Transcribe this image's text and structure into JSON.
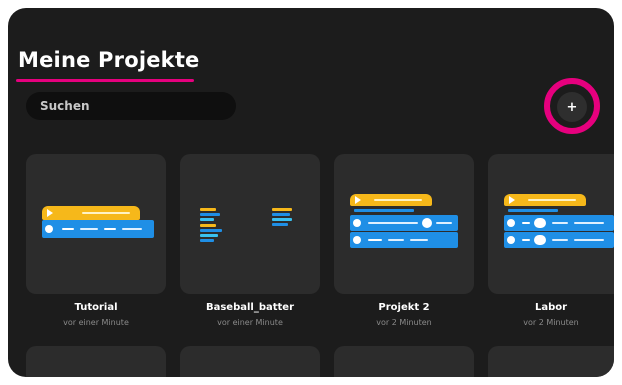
{
  "header": {
    "title": "Meine Projekte"
  },
  "search": {
    "placeholder": "Suchen",
    "value": ""
  },
  "add_button": {
    "label": "+"
  },
  "projects": [
    {
      "title": "Tutorial",
      "time": "vor einer Minute"
    },
    {
      "title": "Baseball_batter",
      "time": "vor einer Minute"
    },
    {
      "title": "Projekt 2",
      "time": "vor 2 Minuten"
    },
    {
      "title": "Labor",
      "time": "vor 2 Minuten"
    }
  ],
  "colors": {
    "accent": "#e6007e",
    "background": "#1c1c1c",
    "card": "#2c2c2c",
    "event_block": "#f6b81a",
    "motor_block": "#1f8fe6"
  }
}
